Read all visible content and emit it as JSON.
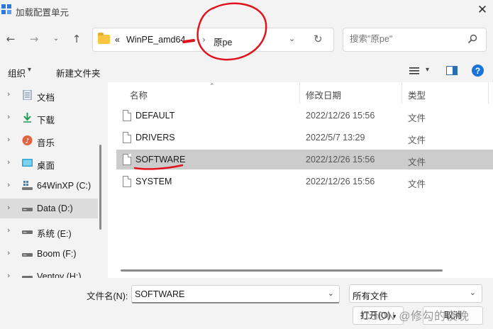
{
  "window": {
    "title": "加载配置单元",
    "close_glyph": "✕"
  },
  "nav": {
    "back_icon": "arrow-left-icon",
    "forward_icon": "arrow-right-icon",
    "history_icon": "chevron-down-icon",
    "up_icon": "arrow-up-icon",
    "breadcrumb": {
      "overflow": "«",
      "segments": [
        "WinPE_amd64",
        "原pe"
      ]
    },
    "refresh_icon": "refresh-icon"
  },
  "search": {
    "placeholder": "搜索\"原pe\""
  },
  "toolbar": {
    "organize_label": "组织",
    "new_folder_label": "新建文件夹"
  },
  "sidebar": {
    "items": [
      {
        "label": "文档",
        "icon": "document-icon"
      },
      {
        "label": "下载",
        "icon": "download-icon"
      },
      {
        "label": "音乐",
        "icon": "music-icon"
      },
      {
        "label": "桌面",
        "icon": "desktop-icon"
      },
      {
        "label": "64WinXP  (C:)",
        "icon": "drive-icon"
      },
      {
        "label": "Data (D:)",
        "icon": "drive-icon",
        "selected": true
      },
      {
        "label": "系统 (E:)",
        "icon": "drive-icon"
      },
      {
        "label": "Boom (F:)",
        "icon": "drive-icon"
      },
      {
        "label": "Ventoy (H:)",
        "icon": "drive-icon"
      }
    ]
  },
  "files": {
    "columns": [
      "名称",
      "修改日期",
      "类型"
    ],
    "rows": [
      {
        "name": "DEFAULT",
        "modified": "2022/12/26 15:56",
        "type": "文件"
      },
      {
        "name": "DRIVERS",
        "modified": "2022/5/7 13:29",
        "type": "文件"
      },
      {
        "name": "SOFTWARE",
        "modified": "2022/12/26 15:56",
        "type": "文件",
        "selected": true
      },
      {
        "name": "SYSTEM",
        "modified": "2022/12/26 15:56",
        "type": "文件"
      }
    ]
  },
  "footer": {
    "filename_label": "文件名(N):",
    "filename_value": "SOFTWARE",
    "filetype_value": "所有文件",
    "open_label": "打开(O)",
    "cancel_label": "取消",
    "watermark": "CSDN @修勾的夜晚"
  },
  "colors": {
    "selection": "#cccccc",
    "annotation_red": "#e0141e",
    "folder": "#f8c640",
    "help": "#1a73d9"
  }
}
